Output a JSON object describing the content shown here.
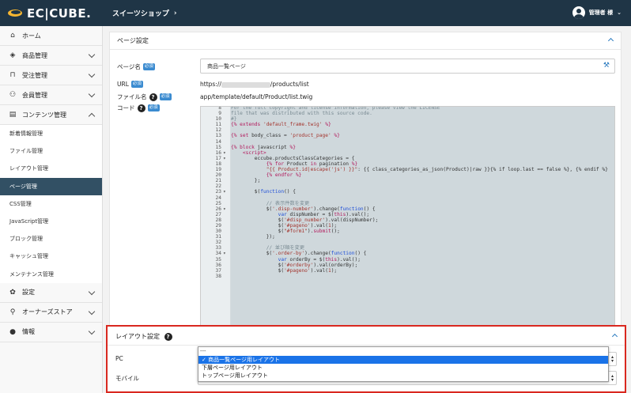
{
  "header": {
    "logo": "EC|CUBE.",
    "shop_name": "スイーツショップ",
    "admin_label": "管理者 様"
  },
  "sidebar": {
    "items": [
      {
        "icon": "home-icon",
        "glyph": "⌂",
        "label": "ホーム",
        "has_chevron": false
      },
      {
        "icon": "box-icon",
        "glyph": "◈",
        "label": "商品管理",
        "has_chevron": true
      },
      {
        "icon": "cart-icon",
        "glyph": "⊓",
        "label": "受注管理",
        "has_chevron": true
      },
      {
        "icon": "users-icon",
        "glyph": "⚇",
        "label": "会員管理",
        "has_chevron": true
      },
      {
        "icon": "file-icon",
        "glyph": "▤",
        "label": "コンテンツ管理",
        "has_chevron": true,
        "expanded": true
      }
    ],
    "sub_items": [
      "新着情報管理",
      "ファイル管理",
      "レイアウト管理",
      "ページ管理",
      "CSS管理",
      "JavaScript管理",
      "ブロック管理",
      "キャッシュ管理",
      "メンテナンス管理"
    ],
    "active_sub": "ページ管理",
    "bottom_items": [
      {
        "icon": "gear-icon",
        "glyph": "✿",
        "label": "設定"
      },
      {
        "icon": "plug-icon",
        "glyph": "⚲",
        "label": "オーナーズストア"
      },
      {
        "icon": "info-icon",
        "glyph": "●",
        "label": "情報"
      }
    ]
  },
  "page_settings": {
    "title": "ページ設定",
    "name_label": "ページ名",
    "required_badge": "必須",
    "name_value": "商品一覧ページ",
    "url_label": "URL",
    "url_prefix": "https://",
    "url_suffix": "/products/list",
    "file_label": "ファイル名",
    "file_value": "app/template/default/Product/list.twig",
    "code_label": "コード"
  },
  "code_lines": [
    {
      "n": "8",
      "f": "",
      "t": [
        [
          "cm",
          "For the full copyright and license information, please view the LICENSE"
        ]
      ]
    },
    {
      "n": "9",
      "f": "",
      "t": [
        [
          "cm",
          "file that was distributed with this source code."
        ]
      ]
    },
    {
      "n": "10",
      "f": "",
      "t": [
        [
          "cm",
          "#}"
        ]
      ]
    },
    {
      "n": "11",
      "f": "",
      "t": [
        [
          "kw",
          "{% extends "
        ],
        [
          "st",
          "'default_frame.twig'"
        ],
        [
          "kw",
          " %}"
        ]
      ]
    },
    {
      "n": "12",
      "f": "",
      "t": []
    },
    {
      "n": "13",
      "f": "",
      "t": [
        [
          "kw",
          "{% set "
        ],
        [
          "c",
          "body_class = "
        ],
        [
          "st",
          "'product_page'"
        ],
        [
          "kw",
          " %}"
        ]
      ]
    },
    {
      "n": "14",
      "f": "",
      "t": []
    },
    {
      "n": "15",
      "f": "",
      "t": [
        [
          "kw",
          "{% block "
        ],
        [
          "c",
          "javascript "
        ],
        [
          "kw",
          "%}"
        ]
      ]
    },
    {
      "n": "16",
      "f": "▾",
      "t": [
        [
          "c",
          "    "
        ],
        [
          "kw",
          "<script>"
        ]
      ]
    },
    {
      "n": "17",
      "f": "▾",
      "t": [
        [
          "c",
          "        eccube.productsClassCategories = {"
        ]
      ]
    },
    {
      "n": "18",
      "f": "",
      "t": [
        [
          "c",
          "            "
        ],
        [
          "kw",
          "{% for "
        ],
        [
          "c",
          "Product "
        ],
        [
          "kw",
          "in "
        ],
        [
          "c",
          "pagination "
        ],
        [
          "kw",
          "%}"
        ]
      ]
    },
    {
      "n": "19",
      "f": "",
      "t": [
        [
          "c",
          "            "
        ],
        [
          "st",
          "\"{{ Product.id|escape('js') }}\""
        ],
        [
          "c",
          ": {{ class_categories_as_json(Product)|raw }}{% if loop.last == false %}, {% endif %}"
        ]
      ]
    },
    {
      "n": "20",
      "f": "",
      "t": [
        [
          "c",
          "            "
        ],
        [
          "kw",
          "{% endfor %}"
        ]
      ]
    },
    {
      "n": "21",
      "f": "",
      "t": [
        [
          "c",
          "        };"
        ]
      ]
    },
    {
      "n": "22",
      "f": "",
      "t": []
    },
    {
      "n": "23",
      "f": "▾",
      "t": [
        [
          "c",
          "        $("
        ],
        [
          "bl",
          "function"
        ],
        [
          "c",
          "() {"
        ]
      ]
    },
    {
      "n": "24",
      "f": "",
      "t": []
    },
    {
      "n": "25",
      "f": "",
      "t": [
        [
          "c",
          "            "
        ],
        [
          "cm",
          "// 表示件数を変更"
        ]
      ]
    },
    {
      "n": "26",
      "f": "▾",
      "t": [
        [
          "c",
          "            $("
        ],
        [
          "st",
          "'.disp-number'"
        ],
        [
          "c",
          ").change("
        ],
        [
          "bl",
          "function"
        ],
        [
          "c",
          "() {"
        ]
      ]
    },
    {
      "n": "27",
      "f": "",
      "t": [
        [
          "c",
          "                "
        ],
        [
          "bl",
          "var "
        ],
        [
          "c",
          "dispNumber = $("
        ],
        [
          "kw",
          "this"
        ],
        [
          "c",
          ").val();"
        ]
      ]
    },
    {
      "n": "28",
      "f": "",
      "t": [
        [
          "c",
          "                $("
        ],
        [
          "st",
          "'#disp_number'"
        ],
        [
          "c",
          ").val(dispNumber);"
        ]
      ]
    },
    {
      "n": "29",
      "f": "",
      "t": [
        [
          "c",
          "                $("
        ],
        [
          "st",
          "'#pageno'"
        ],
        [
          "c",
          ").val("
        ],
        [
          "st",
          "1"
        ],
        [
          "c",
          ");"
        ]
      ]
    },
    {
      "n": "30",
      "f": "",
      "t": [
        [
          "c",
          "                $("
        ],
        [
          "st",
          "\"#form1\""
        ],
        [
          "c",
          ")."
        ],
        [
          "kw",
          "submit"
        ],
        [
          "c",
          "();"
        ]
      ]
    },
    {
      "n": "31",
      "f": "",
      "t": [
        [
          "c",
          "            });"
        ]
      ]
    },
    {
      "n": "32",
      "f": "",
      "t": []
    },
    {
      "n": "33",
      "f": "",
      "t": [
        [
          "c",
          "            "
        ],
        [
          "cm",
          "// 並び順を変更"
        ]
      ]
    },
    {
      "n": "34",
      "f": "▾",
      "t": [
        [
          "c",
          "            $("
        ],
        [
          "st",
          "'.order-by'"
        ],
        [
          "c",
          ").change("
        ],
        [
          "bl",
          "function"
        ],
        [
          "c",
          "() {"
        ]
      ]
    },
    {
      "n": "35",
      "f": "",
      "t": [
        [
          "c",
          "                "
        ],
        [
          "bl",
          "var "
        ],
        [
          "c",
          "orderBy = $("
        ],
        [
          "kw",
          "this"
        ],
        [
          "c",
          ").val();"
        ]
      ]
    },
    {
      "n": "36",
      "f": "",
      "t": [
        [
          "c",
          "                $("
        ],
        [
          "st",
          "'#orderby'"
        ],
        [
          "c",
          ").val(orderBy);"
        ]
      ]
    },
    {
      "n": "37",
      "f": "",
      "t": [
        [
          "c",
          "                $("
        ],
        [
          "st",
          "'#pageno'"
        ],
        [
          "c",
          ").val("
        ],
        [
          "st",
          "1"
        ],
        [
          "c",
          ");"
        ]
      ]
    },
    {
      "n": "38",
      "f": "",
      "t": []
    }
  ],
  "layout_settings": {
    "title": "レイアウト設定",
    "pc_label": "PC",
    "mobile_label": "モバイル",
    "options": [
      "---",
      "商品一覧ページ用レイアウト",
      "下層ページ用レイアウト",
      "トップページ用レイアウト"
    ],
    "selected_index": 1,
    "check": "✓"
  }
}
